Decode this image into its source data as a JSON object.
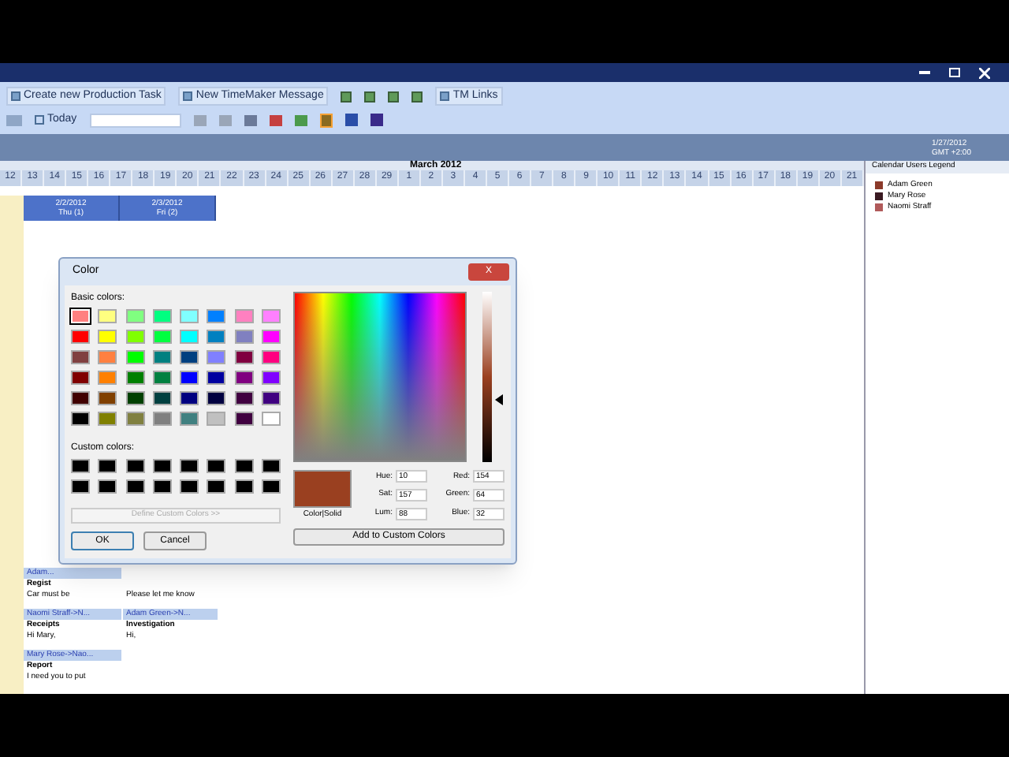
{
  "toolbar": {
    "row1": [
      {
        "kind": "button",
        "label": "Create new Production Task"
      },
      {
        "kind": "button",
        "label": "New TimeMaker Message"
      },
      {
        "kind": "icons"
      },
      {
        "kind": "button",
        "label": "TM Links"
      }
    ],
    "today": "Today"
  },
  "status": {
    "date": "1/27/2012",
    "zone": "GMT +2:00"
  },
  "timeline": {
    "month": "March 2012",
    "days": [
      "12",
      "13",
      "14",
      "15",
      "16",
      "17",
      "18",
      "19",
      "20",
      "21",
      "22",
      "23",
      "24",
      "25",
      "26",
      "27",
      "28",
      "29",
      "1",
      "2",
      "3",
      "4",
      "5",
      "6",
      "7",
      "8",
      "9",
      "10",
      "11",
      "12",
      "13",
      "14",
      "15",
      "16",
      "17",
      "18",
      "19",
      "20",
      "21"
    ]
  },
  "day_headers": [
    {
      "date": "2/2/2012",
      "day": "Thu (1)"
    },
    {
      "date": "2/3/2012",
      "day": "Fri (2)"
    }
  ],
  "cards": [
    {
      "header": "Adam...",
      "title": "Regist",
      "body": "Car must be"
    },
    {
      "body": "Please let me know"
    },
    {
      "header": "Naomi Straff->N...",
      "title": "Receipts",
      "body": "Hi Mary,"
    },
    {
      "header": "Adam Green->N...",
      "title": "Investigation",
      "body": "Hi,"
    },
    {
      "header": "Mary Rose->Nao...",
      "title": "Report",
      "body": "I need you to put"
    }
  ],
  "legend": {
    "title": "Calendar Users Legend",
    "items": [
      {
        "name": "Adam Green",
        "color": "#8b3a2a"
      },
      {
        "name": "Mary Rose",
        "color": "#3a1a22"
      },
      {
        "name": "Naomi Straff",
        "color": "#b05a5a"
      }
    ]
  },
  "dialog": {
    "title": "Color",
    "close": "X",
    "basic_label": "Basic colors:",
    "basic": [
      {
        "color": "#ff8080",
        "selected": true
      },
      {
        "color": "#ffff80",
        "selected": false
      },
      {
        "color": "#80ff80",
        "selected": false
      },
      {
        "color": "#00ff80",
        "selected": false
      },
      {
        "color": "#80ffff",
        "selected": false
      },
      {
        "color": "#0080ff",
        "selected": false
      },
      {
        "color": "#ff80c0",
        "selected": false
      },
      {
        "color": "#ff80ff",
        "selected": false
      },
      {
        "color": "#ff0000",
        "selected": false
      },
      {
        "color": "#ffff00",
        "selected": false
      },
      {
        "color": "#80ff00",
        "selected": false
      },
      {
        "color": "#00ff40",
        "selected": false
      },
      {
        "color": "#00ffff",
        "selected": false
      },
      {
        "color": "#0080c0",
        "selected": false
      },
      {
        "color": "#8080c0",
        "selected": false
      },
      {
        "color": "#ff00ff",
        "selected": false
      },
      {
        "color": "#804040",
        "selected": false
      },
      {
        "color": "#ff8040",
        "selected": false
      },
      {
        "color": "#00ff00",
        "selected": false
      },
      {
        "color": "#008080",
        "selected": false
      },
      {
        "color": "#004080",
        "selected": false
      },
      {
        "color": "#8080ff",
        "selected": false
      },
      {
        "color": "#800040",
        "selected": false
      },
      {
        "color": "#ff0080",
        "selected": false
      },
      {
        "color": "#800000",
        "selected": false
      },
      {
        "color": "#ff8000",
        "selected": false
      },
      {
        "color": "#008000",
        "selected": false
      },
      {
        "color": "#008040",
        "selected": false
      },
      {
        "color": "#0000ff",
        "selected": false
      },
      {
        "color": "#0000a0",
        "selected": false
      },
      {
        "color": "#800080",
        "selected": false
      },
      {
        "color": "#8000ff",
        "selected": false
      },
      {
        "color": "#400000",
        "selected": false
      },
      {
        "color": "#804000",
        "selected": false
      },
      {
        "color": "#004000",
        "selected": false
      },
      {
        "color": "#004040",
        "selected": false
      },
      {
        "color": "#000080",
        "selected": false
      },
      {
        "color": "#000040",
        "selected": false
      },
      {
        "color": "#400040",
        "selected": false
      },
      {
        "color": "#400080",
        "selected": false
      },
      {
        "color": "#000000",
        "selected": false
      },
      {
        "color": "#808000",
        "selected": false
      },
      {
        "color": "#808040",
        "selected": false
      },
      {
        "color": "#808080",
        "selected": false
      },
      {
        "color": "#408080",
        "selected": false
      },
      {
        "color": "#c0c0c0",
        "selected": false
      },
      {
        "color": "#400040",
        "selected": false
      },
      {
        "color": "#ffffff",
        "selected": false
      }
    ],
    "custom_label": "Custom colors:",
    "custom": [
      {
        "color": "#000000"
      },
      {
        "color": "#000000"
      },
      {
        "color": "#000000"
      },
      {
        "color": "#000000"
      },
      {
        "color": "#000000"
      },
      {
        "color": "#000000"
      },
      {
        "color": "#000000"
      },
      {
        "color": "#000000"
      },
      {
        "color": "#000000"
      },
      {
        "color": "#000000"
      },
      {
        "color": "#000000"
      },
      {
        "color": "#000000"
      },
      {
        "color": "#000000"
      },
      {
        "color": "#000000"
      },
      {
        "color": "#000000"
      },
      {
        "color": "#000000"
      }
    ],
    "define": "Define Custom Colors >>",
    "ok": "OK",
    "cancel": "Cancel",
    "preview": {
      "color": "#9a4020",
      "label": "Color|Solid"
    },
    "lum": {
      "level": 0.37
    },
    "fields": [
      {
        "label": "Hue:",
        "value": "10"
      },
      {
        "label": "Red:",
        "value": "154"
      },
      {
        "label": "Sat:",
        "value": "157"
      },
      {
        "label": "Green:",
        "value": "64"
      },
      {
        "label": "Lum:",
        "value": "88"
      },
      {
        "label": "Blue:",
        "value": "32"
      }
    ],
    "add": "Add to Custom Colors"
  }
}
